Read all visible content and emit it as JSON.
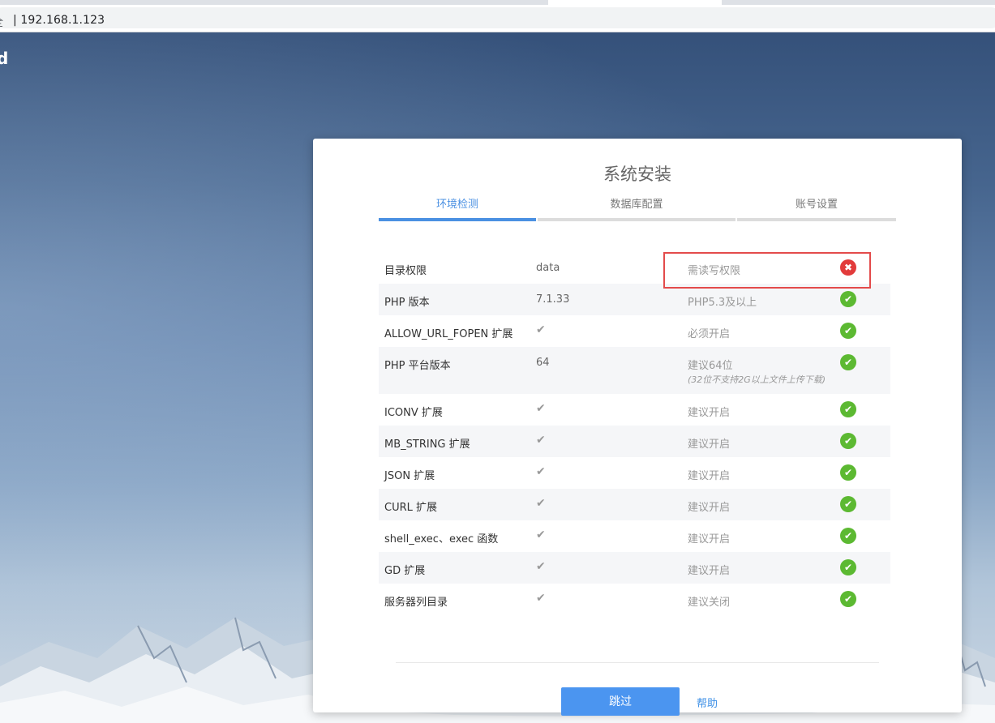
{
  "browser": {
    "security_label": "全",
    "url": "| 192.168.1.123"
  },
  "background": {
    "corner_text": "d"
  },
  "installer": {
    "title": "系统安装",
    "steps": [
      {
        "label": "环境检测",
        "active": true
      },
      {
        "label": "数据库配置",
        "active": false
      },
      {
        "label": "账号设置",
        "active": false
      }
    ],
    "checks": [
      {
        "name": "目录权限",
        "value": "data",
        "requirement": "需读写权限",
        "note": "",
        "status": "fail"
      },
      {
        "name": "PHP 版本",
        "value": "7.1.33",
        "requirement": "PHP5.3及以上",
        "note": "",
        "status": "ok"
      },
      {
        "name": "ALLOW_URL_FOPEN 扩展",
        "value": "✔",
        "requirement": "必须开启",
        "note": "",
        "status": "ok"
      },
      {
        "name": "PHP 平台版本",
        "value": "64",
        "requirement": "建议64位",
        "note": "(32位不支持2G以上文件上传下载)",
        "status": "ok"
      },
      {
        "name": "ICONV 扩展",
        "value": "✔",
        "requirement": "建议开启",
        "note": "",
        "status": "ok"
      },
      {
        "name": "MB_STRING 扩展",
        "value": "✔",
        "requirement": "建议开启",
        "note": "",
        "status": "ok"
      },
      {
        "name": "JSON 扩展",
        "value": "✔",
        "requirement": "建议开启",
        "note": "",
        "status": "ok"
      },
      {
        "name": "CURL 扩展",
        "value": "✔",
        "requirement": "建议开启",
        "note": "",
        "status": "ok"
      },
      {
        "name": "shell_exec、exec 函数",
        "value": "✔",
        "requirement": "建议开启",
        "note": "",
        "status": "ok"
      },
      {
        "name": "GD 扩展",
        "value": "✔",
        "requirement": "建议开启",
        "note": "",
        "status": "ok"
      },
      {
        "name": "服务器列目录",
        "value": "✔",
        "requirement": "建议关闭",
        "note": "",
        "status": "ok"
      }
    ],
    "status_icons": {
      "ok": "✔",
      "fail": "✖"
    },
    "skip_button": "跳过",
    "help_link": "帮助",
    "colors": {
      "accent": "#4a90e2",
      "ok": "#5cb932",
      "fail": "#e23b3b",
      "highlight": "#e34b4b"
    }
  }
}
